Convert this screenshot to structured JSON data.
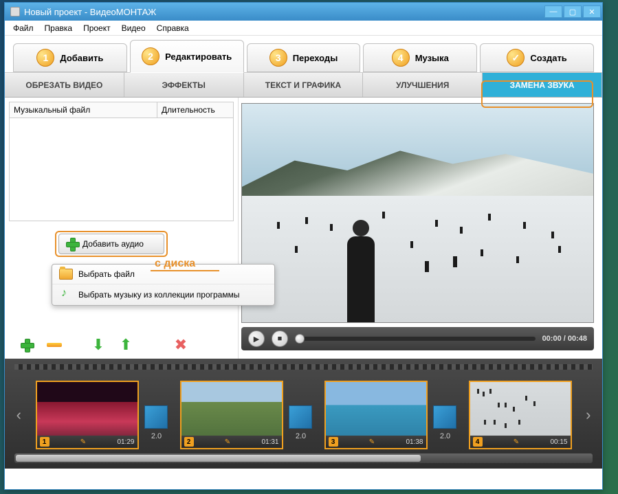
{
  "window": {
    "title": "Новый проект - ВидеоМОНТАЖ"
  },
  "menu": {
    "file": "Файл",
    "edit": "Правка",
    "project": "Проект",
    "video": "Видео",
    "help": "Справка"
  },
  "steps": {
    "s1": "Добавить",
    "s2": "Редактировать",
    "s3": "Переходы",
    "s4": "Музыка",
    "s5": "Создать"
  },
  "subtabs": {
    "trim": "ОБРЕЗАТЬ ВИДЕО",
    "effects": "ЭФФЕКТЫ",
    "text": "ТЕКСТ И ГРАФИКА",
    "enhance": "УЛУЧШЕНИЯ",
    "audio": "ЗАМЕНА ЗВУКА"
  },
  "filelist": {
    "col_name": "Музыкальный файл",
    "col_dur": "Длительность"
  },
  "add_audio": {
    "label": "Добавить аудио"
  },
  "dropdown": {
    "item1": "Выбрать файл",
    "item2": "Выбрать музыку из коллекции программы"
  },
  "annotation": {
    "text": "с диска"
  },
  "player": {
    "time": "00:00 / 00:48"
  },
  "timeline": {
    "t_dur": "2.0",
    "clips": [
      {
        "num": "1",
        "dur": "01:29"
      },
      {
        "num": "2",
        "dur": "01:31"
      },
      {
        "num": "3",
        "dur": "01:38"
      },
      {
        "num": "4",
        "dur": "00:15"
      }
    ]
  }
}
